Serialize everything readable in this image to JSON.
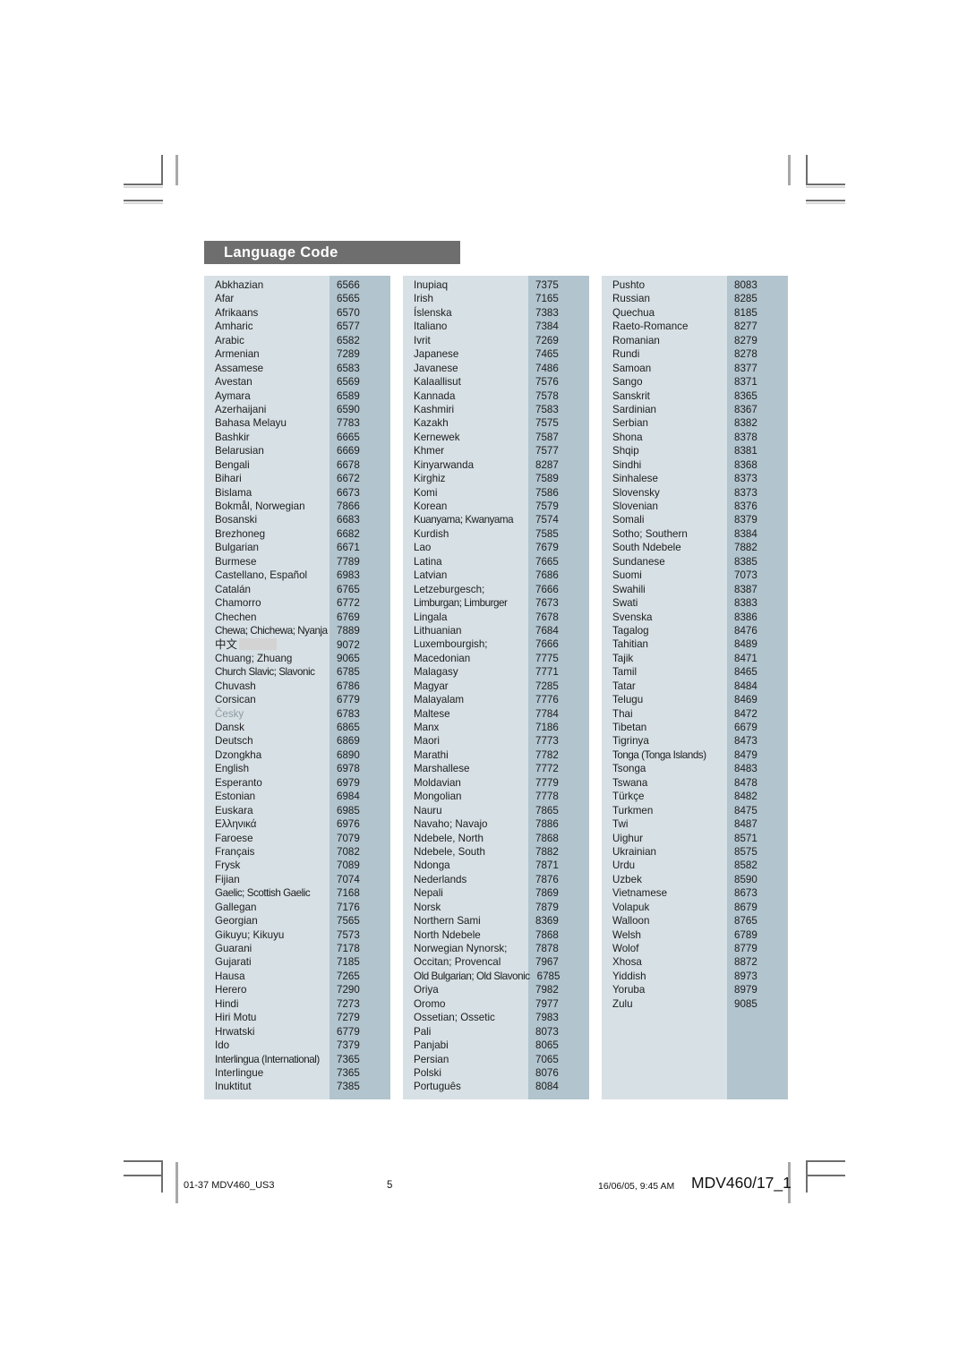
{
  "page": {
    "title": "Language Code",
    "title_bar_color": "#6e6e6e",
    "name_cell_color": "#d7e0e5",
    "code_cell_color": "#b2c4cd"
  },
  "footer": {
    "left": "01-37 MDV460_US3",
    "page_number": "5",
    "date": "16/06/05, 9:45 AM",
    "doc_id": "MDV460/17_1"
  },
  "columns": [
    {
      "id": "column-1",
      "rows": [
        {
          "name": "Abkhazian",
          "code": "6566"
        },
        {
          "name": "Afar",
          "code": "6565"
        },
        {
          "name": "Afrikaans",
          "code": "6570"
        },
        {
          "name": "Amharic",
          "code": "6577"
        },
        {
          "name": "Arabic",
          "code": "6582"
        },
        {
          "name": "Armenian",
          "code": "7289"
        },
        {
          "name": "Assamese",
          "code": "6583"
        },
        {
          "name": "Avestan",
          "code": "6569"
        },
        {
          "name": "Aymara",
          "code": "6589"
        },
        {
          "name": "Azerhaijani",
          "code": "6590"
        },
        {
          "name": "Bahasa Melayu",
          "code": "7783"
        },
        {
          "name": "Bashkir",
          "code": "6665"
        },
        {
          "name": "Belarusian",
          "code": "6669"
        },
        {
          "name": "Bengali",
          "code": "6678"
        },
        {
          "name": "Bihari",
          "code": "6672"
        },
        {
          "name": "Bislama",
          "code": "6673"
        },
        {
          "name": "Bokmål, Norwegian",
          "code": "7866"
        },
        {
          "name": "Bosanski",
          "code": "6683"
        },
        {
          "name": "Brezhoneg",
          "code": "6682"
        },
        {
          "name": "Bulgarian",
          "code": "6671"
        },
        {
          "name": "Burmese",
          "code": "7789"
        },
        {
          "name": "Castellano, Español",
          "code": "6983"
        },
        {
          "name": "Catalán",
          "code": "6765"
        },
        {
          "name": "Chamorro",
          "code": "6772"
        },
        {
          "name": "Chechen",
          "code": "6769"
        },
        {
          "name": "Chewa; Chichewa; Nyanja",
          "code": "7889",
          "narrow": true
        },
        {
          "name": "中文",
          "code": "9072",
          "cjk": true,
          "tofu": true
        },
        {
          "name": "Chuang; Zhuang",
          "code": "9065"
        },
        {
          "name": "Church Slavic; Slavonic",
          "code": "6785",
          "narrow": true
        },
        {
          "name": "Chuvash",
          "code": "6786"
        },
        {
          "name": "Corsican",
          "code": "6779"
        },
        {
          "name": "Česky",
          "code": "6783",
          "dim": true
        },
        {
          "name": "Dansk",
          "code": "6865"
        },
        {
          "name": "Deutsch",
          "code": "6869"
        },
        {
          "name": "Dzongkha",
          "code": "6890"
        },
        {
          "name": "English",
          "code": "6978"
        },
        {
          "name": "Esperanto",
          "code": "6979"
        },
        {
          "name": "Estonian",
          "code": "6984"
        },
        {
          "name": "Euskara",
          "code": "6985"
        },
        {
          "name": "Ελληνικά",
          "code": "6976"
        },
        {
          "name": "Faroese",
          "code": "7079"
        },
        {
          "name": "Français",
          "code": "7082"
        },
        {
          "name": "Frysk",
          "code": "7089"
        },
        {
          "name": "Fijian",
          "code": "7074"
        },
        {
          "name": "Gaelic; Scottish Gaelic",
          "code": "7168",
          "narrow": true
        },
        {
          "name": "Gallegan",
          "code": "7176"
        },
        {
          "name": "Georgian",
          "code": "7565"
        },
        {
          "name": "Gikuyu; Kikuyu",
          "code": "7573"
        },
        {
          "name": "Guarani",
          "code": "7178"
        },
        {
          "name": "Gujarati",
          "code": "7185"
        },
        {
          "name": "Hausa",
          "code": "7265"
        },
        {
          "name": "Herero",
          "code": "7290"
        },
        {
          "name": "Hindi",
          "code": "7273"
        },
        {
          "name": "Hiri Motu",
          "code": "7279"
        },
        {
          "name": "Hrwatski",
          "code": "6779"
        },
        {
          "name": "Ido",
          "code": "7379"
        },
        {
          "name": "Interlingua (International)",
          "code": "7365",
          "narrow": true
        },
        {
          "name": "Interlingue",
          "code": "7365"
        },
        {
          "name": "Inuktitut",
          "code": "7385"
        }
      ]
    },
    {
      "id": "column-2",
      "rows": [
        {
          "name": "Inupiaq",
          "code": "7375"
        },
        {
          "name": "Irish",
          "code": "7165"
        },
        {
          "name": "Íslenska",
          "code": "7383"
        },
        {
          "name": "Italiano",
          "code": "7384"
        },
        {
          "name": "Ivrit",
          "code": "7269"
        },
        {
          "name": "Japanese",
          "code": "7465"
        },
        {
          "name": "Javanese",
          "code": "7486"
        },
        {
          "name": "Kalaallisut",
          "code": "7576"
        },
        {
          "name": "Kannada",
          "code": "7578"
        },
        {
          "name": "Kashmiri",
          "code": "7583"
        },
        {
          "name": "Kazakh",
          "code": "7575"
        },
        {
          "name": "Kernewek",
          "code": "7587"
        },
        {
          "name": "Khmer",
          "code": "7577"
        },
        {
          "name": "Kinyarwanda",
          "code": "8287"
        },
        {
          "name": "Kirghiz",
          "code": "7589"
        },
        {
          "name": "Komi",
          "code": "7586"
        },
        {
          "name": "Korean",
          "code": "7579"
        },
        {
          "name": "Kuanyama; Kwanyama",
          "code": "7574",
          "narrow": true
        },
        {
          "name": "Kurdish",
          "code": "7585"
        },
        {
          "name": "Lao",
          "code": "7679"
        },
        {
          "name": "Latina",
          "code": "7665"
        },
        {
          "name": "Latvian",
          "code": "7686"
        },
        {
          "name": "Letzeburgesch;",
          "code": "7666"
        },
        {
          "name": "Limburgan; Limburger",
          "code": "7673",
          "narrow": true
        },
        {
          "name": "Lingala",
          "code": "7678"
        },
        {
          "name": "Lithuanian",
          "code": "7684"
        },
        {
          "name": "Luxembourgish;",
          "code": "7666"
        },
        {
          "name": "Macedonian",
          "code": "7775"
        },
        {
          "name": "Malagasy",
          "code": "7771"
        },
        {
          "name": "Magyar",
          "code": "7285"
        },
        {
          "name": "Malayalam",
          "code": "7776"
        },
        {
          "name": "Maltese",
          "code": "7784"
        },
        {
          "name": "Manx",
          "code": "7186"
        },
        {
          "name": "Maori",
          "code": "7773"
        },
        {
          "name": "Marathi",
          "code": "7782"
        },
        {
          "name": "Marshallese",
          "code": "7772"
        },
        {
          "name": "Moldavian",
          "code": "7779"
        },
        {
          "name": "Mongolian",
          "code": "7778"
        },
        {
          "name": "Nauru",
          "code": "7865"
        },
        {
          "name": "Navaho; Navajo",
          "code": "7886"
        },
        {
          "name": "Ndebele, North",
          "code": "7868"
        },
        {
          "name": "Ndebele, South",
          "code": "7882"
        },
        {
          "name": "Ndonga",
          "code": "7871"
        },
        {
          "name": "Nederlands",
          "code": "7876"
        },
        {
          "name": "Nepali",
          "code": "7869"
        },
        {
          "name": "Norsk",
          "code": "7879"
        },
        {
          "name": "Northern Sami",
          "code": "8369"
        },
        {
          "name": "North Ndebele",
          "code": "7868"
        },
        {
          "name": "Norwegian Nynorsk;",
          "code": "7878"
        },
        {
          "name": "Occitan; Provencal",
          "code": "7967"
        },
        {
          "name": "Old Bulgarian; Old Slavonic",
          "code": "6785",
          "narrow": true
        },
        {
          "name": "Oriya",
          "code": "7982"
        },
        {
          "name": "Oromo",
          "code": "7977"
        },
        {
          "name": "Ossetian; Ossetic",
          "code": "7983"
        },
        {
          "name": "Pali",
          "code": "8073"
        },
        {
          "name": "Panjabi",
          "code": "8065"
        },
        {
          "name": "Persian",
          "code": "7065"
        },
        {
          "name": "Polski",
          "code": "8076"
        },
        {
          "name": "Português",
          "code": "8084"
        }
      ]
    },
    {
      "id": "column-3",
      "rows": [
        {
          "name": "Pushto",
          "code": "8083"
        },
        {
          "name": "Russian",
          "code": "8285"
        },
        {
          "name": "Quechua",
          "code": "8185"
        },
        {
          "name": "Raeto-Romance",
          "code": "8277"
        },
        {
          "name": "Romanian",
          "code": "8279"
        },
        {
          "name": "Rundi",
          "code": "8278"
        },
        {
          "name": "Samoan",
          "code": "8377"
        },
        {
          "name": "Sango",
          "code": "8371"
        },
        {
          "name": "Sanskrit",
          "code": "8365"
        },
        {
          "name": "Sardinian",
          "code": "8367"
        },
        {
          "name": "Serbian",
          "code": "8382"
        },
        {
          "name": "Shona",
          "code": "8378"
        },
        {
          "name": "Shqip",
          "code": "8381"
        },
        {
          "name": "Sindhi",
          "code": "8368"
        },
        {
          "name": "Sinhalese",
          "code": "8373"
        },
        {
          "name": "Slovensky",
          "code": "8373"
        },
        {
          "name": "Slovenian",
          "code": "8376"
        },
        {
          "name": "Somali",
          "code": "8379"
        },
        {
          "name": "Sotho; Southern",
          "code": "8384"
        },
        {
          "name": "South Ndebele",
          "code": "7882"
        },
        {
          "name": "Sundanese",
          "code": "8385"
        },
        {
          "name": "Suomi",
          "code": "7073"
        },
        {
          "name": "Swahili",
          "code": "8387"
        },
        {
          "name": "Swati",
          "code": "8383"
        },
        {
          "name": "Svenska",
          "code": "8386"
        },
        {
          "name": "Tagalog",
          "code": "8476"
        },
        {
          "name": "Tahitian",
          "code": "8489"
        },
        {
          "name": "Tajik",
          "code": "8471"
        },
        {
          "name": "Tamil",
          "code": "8465"
        },
        {
          "name": "Tatar",
          "code": "8484"
        },
        {
          "name": "Telugu",
          "code": "8469"
        },
        {
          "name": "Thai",
          "code": "8472"
        },
        {
          "name": "Tibetan",
          "code": "6679"
        },
        {
          "name": "Tigrinya",
          "code": "8473"
        },
        {
          "name": "Tonga (Tonga Islands)",
          "code": "8479",
          "narrow": true
        },
        {
          "name": "Tsonga",
          "code": "8483"
        },
        {
          "name": "Tswana",
          "code": "8478"
        },
        {
          "name": "Türkçe",
          "code": "8482"
        },
        {
          "name": "Turkmen",
          "code": "8475"
        },
        {
          "name": "Twi",
          "code": "8487"
        },
        {
          "name": "Uighur",
          "code": "8571"
        },
        {
          "name": "Ukrainian",
          "code": "8575"
        },
        {
          "name": "Urdu",
          "code": "8582"
        },
        {
          "name": "Uzbek",
          "code": "8590"
        },
        {
          "name": "Vietnamese",
          "code": "8673"
        },
        {
          "name": "Volapuk",
          "code": "8679"
        },
        {
          "name": "Walloon",
          "code": "8765"
        },
        {
          "name": "Welsh",
          "code": "6789"
        },
        {
          "name": "Wolof",
          "code": "8779"
        },
        {
          "name": "Xhosa",
          "code": "8872"
        },
        {
          "name": "Yiddish",
          "code": "8973"
        },
        {
          "name": "Yoruba",
          "code": "8979"
        },
        {
          "name": "Zulu",
          "code": "9085"
        }
      ]
    }
  ]
}
